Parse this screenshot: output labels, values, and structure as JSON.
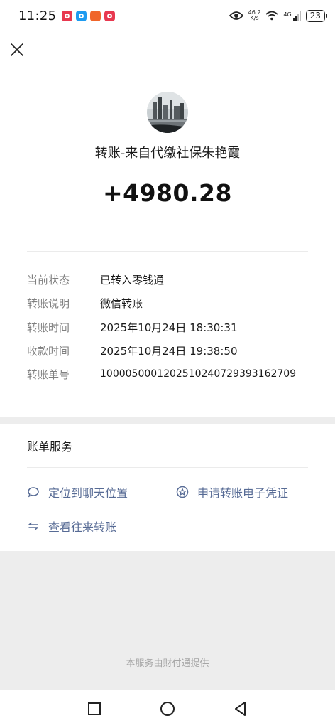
{
  "status_bar": {
    "time": "11:25",
    "speed_value": "46.2",
    "speed_unit": "K/s",
    "network": "4G",
    "battery": "23"
  },
  "header": {
    "close_icon": "close-icon"
  },
  "transfer": {
    "title": "转账-来自代缴社保朱艳霞",
    "amount": "+4980.28",
    "details": [
      {
        "label": "当前状态",
        "value": "已转入零钱通"
      },
      {
        "label": "转账说明",
        "value": "微信转账"
      },
      {
        "label": "转账时间",
        "value": "2025年10月24日 18:30:31"
      },
      {
        "label": "收款时间",
        "value": "2025年10月24日 19:38:50"
      },
      {
        "label": "转账单号",
        "value": "1000050001202510240729393162709"
      }
    ]
  },
  "bill_services": {
    "title": "账单服务",
    "links": [
      {
        "label": "定位到聊天位置",
        "icon": "chat-bubble-icon"
      },
      {
        "label": "申请转账电子凭证",
        "icon": "star-badge-icon"
      },
      {
        "label": "查看往来转账",
        "icon": "exchange-arrows-icon"
      }
    ]
  },
  "footer": {
    "provider_text": "本服务由财付通提供"
  },
  "colors": {
    "link": "#576b95",
    "label": "#7f7f7f",
    "background": "#ededed"
  }
}
